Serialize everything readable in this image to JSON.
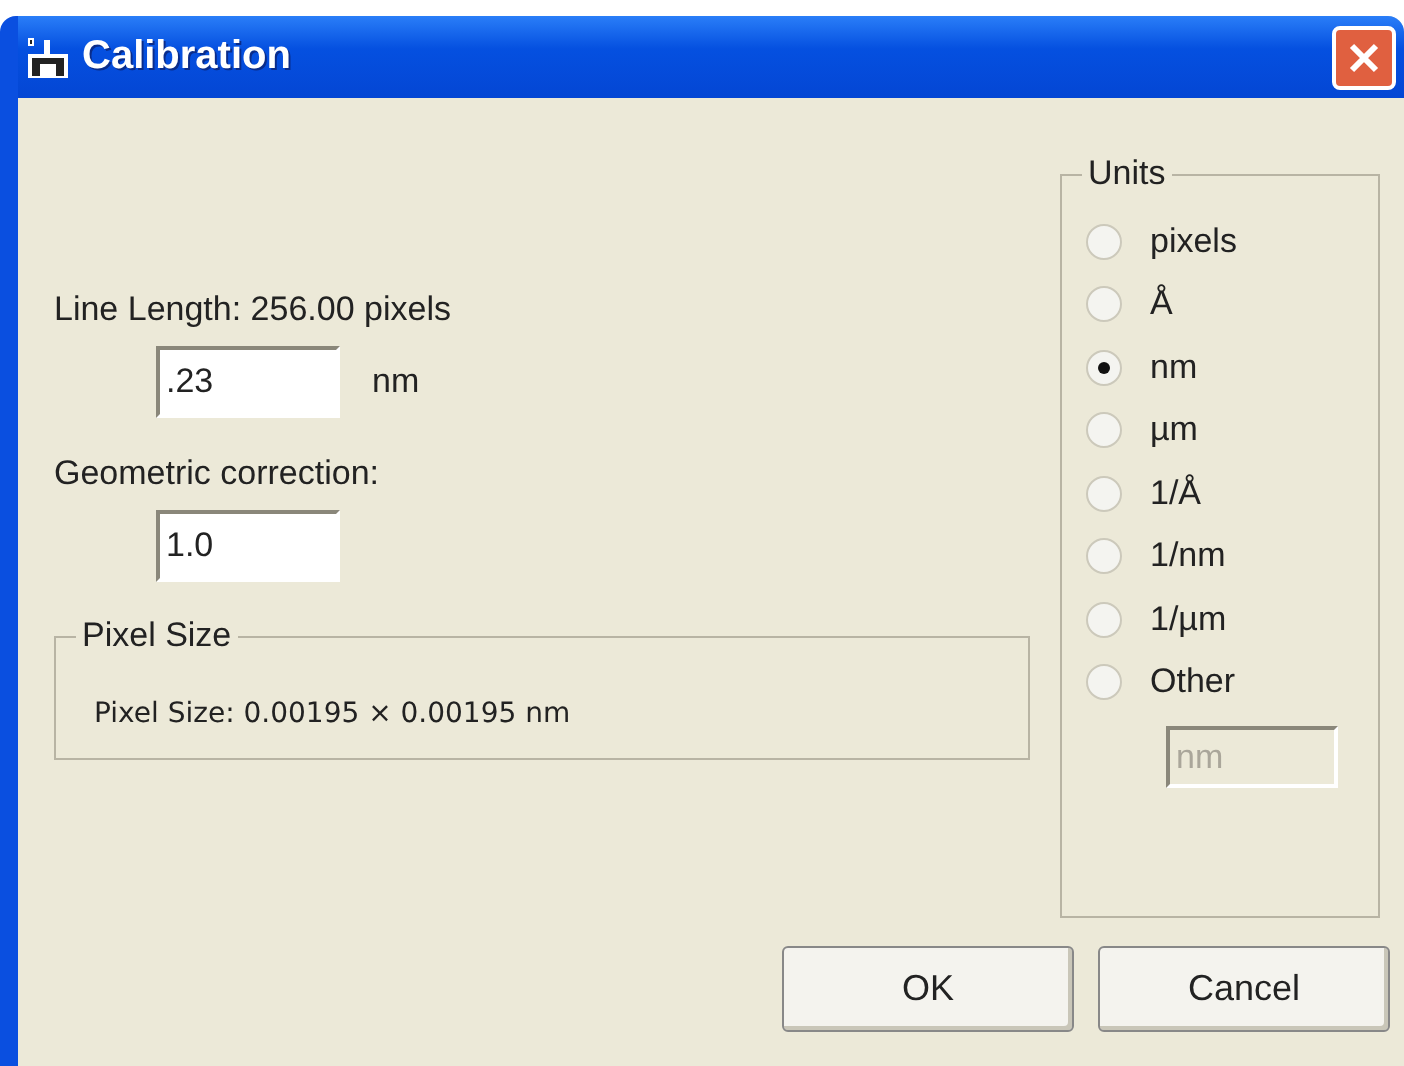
{
  "window": {
    "title": "Calibration"
  },
  "line_length": "Line Length: 256.00 pixels",
  "length_field": {
    "value": ".23",
    "unit": "nm"
  },
  "correction": {
    "label": "Geometric correction:",
    "value": "1.0"
  },
  "pixel_size": {
    "title": "Pixel Size",
    "text": "Pixel Size: 0.00195 × 0.00195 nm"
  },
  "units": {
    "title": "Units",
    "options": [
      {
        "label": "pixels",
        "selected": false
      },
      {
        "label": "Å",
        "selected": false
      },
      {
        "label": "nm",
        "selected": true
      },
      {
        "label": "µm",
        "selected": false
      },
      {
        "label": "1/Å",
        "selected": false
      },
      {
        "label": "1/nm",
        "selected": false
      },
      {
        "label": "1/µm",
        "selected": false
      },
      {
        "label": "Other",
        "selected": false
      }
    ],
    "other_field": {
      "value": "nm",
      "disabled": true
    }
  },
  "buttons": [
    "OK",
    "Cancel"
  ]
}
